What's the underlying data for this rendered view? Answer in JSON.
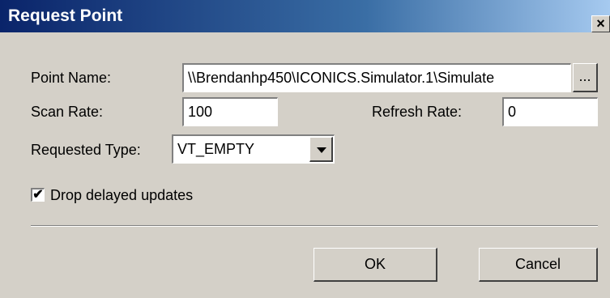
{
  "dialog": {
    "title": "Request Point",
    "close_glyph": "×"
  },
  "fields": {
    "point_name_label": "Point Name:",
    "point_name_value": "\\\\Brendanhp450\\ICONICS.Simulator.1\\Simulate",
    "browse_label": "...",
    "scan_rate_label": "Scan Rate:",
    "scan_rate_value": "100",
    "refresh_rate_label": "Refresh Rate:",
    "refresh_rate_value": "0",
    "requested_type_label": "Requested Type:",
    "requested_type_value": "VT_EMPTY"
  },
  "options": {
    "drop_delayed_label": "Drop delayed updates",
    "drop_delayed_checked": true,
    "check_glyph": "✔"
  },
  "buttons": {
    "ok_label": "OK",
    "cancel_label": "Cancel"
  },
  "colors": {
    "titlebar_start": "#0a246a",
    "titlebar_end": "#a6caf0",
    "dialog_bg": "#d4d0c8"
  }
}
